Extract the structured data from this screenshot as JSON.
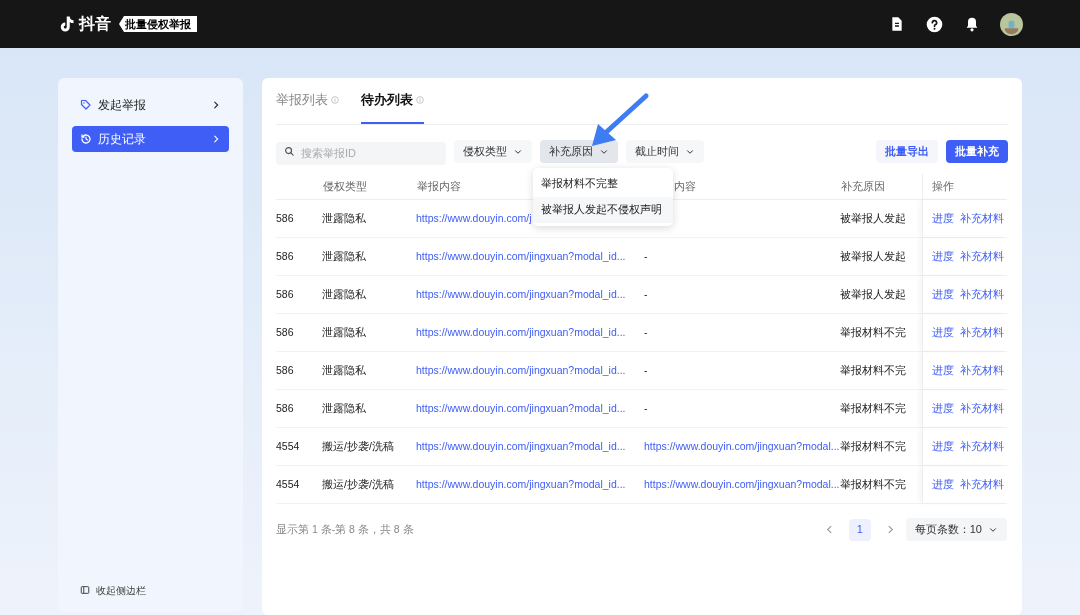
{
  "header": {
    "logo_text": "抖音",
    "badge": "批量侵权举报"
  },
  "sidebar": {
    "items": [
      {
        "label": "发起举报",
        "selected": false
      },
      {
        "label": "历史记录",
        "selected": true
      }
    ],
    "collapse": "收起侧边栏"
  },
  "tabs": [
    {
      "label": "举报列表",
      "selected": false
    },
    {
      "label": "待办列表",
      "selected": true
    }
  ],
  "filters": {
    "search": {
      "placeholder": "搜索举报ID"
    },
    "dropdowns": [
      {
        "label": "侵权类型",
        "open": false
      },
      {
        "label": "补充原因",
        "open": true
      },
      {
        "label": "截止时间",
        "open": false
      }
    ],
    "buttons": [
      {
        "label": "批量导出",
        "kind": "secondary"
      },
      {
        "label": "批量补充",
        "kind": "primary"
      }
    ]
  },
  "dropdown_menu": [
    "举报材料不完整",
    "被举报人发起不侵权声明"
  ],
  "table": {
    "columns": [
      "",
      "侵权类型",
      "举报内容",
      "内容",
      "补充原因",
      "操作"
    ],
    "rows": [
      {
        "cells": [
          "586",
          "泄露隐私",
          "https://www.douyin.com/j",
          "",
          "被举报人发起"
        ],
        "actions": [
          "进度",
          "补充材料"
        ]
      },
      {
        "cells": [
          "586",
          "泄露隐私",
          "https://www.douyin.com/jingxuan?modal_id...",
          "-",
          "被举报人发起"
        ],
        "actions": [
          "进度",
          "补充材料"
        ]
      },
      {
        "cells": [
          "586",
          "泄露隐私",
          "https://www.douyin.com/jingxuan?modal_id...",
          "-",
          "被举报人发起"
        ],
        "actions": [
          "进度",
          "补充材料"
        ]
      },
      {
        "cells": [
          "586",
          "泄露隐私",
          "https://www.douyin.com/jingxuan?modal_id...",
          "-",
          "举报材料不完"
        ],
        "actions": [
          "进度",
          "补充材料"
        ]
      },
      {
        "cells": [
          "586",
          "泄露隐私",
          "https://www.douyin.com/jingxuan?modal_id...",
          "-",
          "举报材料不完"
        ],
        "actions": [
          "进度",
          "补充材料"
        ]
      },
      {
        "cells": [
          "586",
          "泄露隐私",
          "https://www.douyin.com/jingxuan?modal_id...",
          "-",
          "举报材料不完"
        ],
        "actions": [
          "进度",
          "补充材料"
        ]
      },
      {
        "cells": [
          "4554",
          "搬运/抄袭/洗稿",
          "https://www.douyin.com/jingxuan?modal_id...",
          "https://www.douyin.com/jingxuan?modal...",
          "举报材料不完"
        ],
        "actions": [
          "进度",
          "补充材料"
        ]
      },
      {
        "cells": [
          "4554",
          "搬运/抄袭/洗稿",
          "https://www.douyin.com/jingxuan?modal_id...",
          "https://www.douyin.com/jingxuan?modal...",
          "举报材料不完"
        ],
        "actions": [
          "进度",
          "补充材料"
        ]
      }
    ]
  },
  "footer": {
    "summary": "显示第 1 条-第 8 条，共 8 条",
    "pages": [
      {
        "label": "1",
        "selected": true
      }
    ],
    "page_size": "每页条数：10"
  }
}
